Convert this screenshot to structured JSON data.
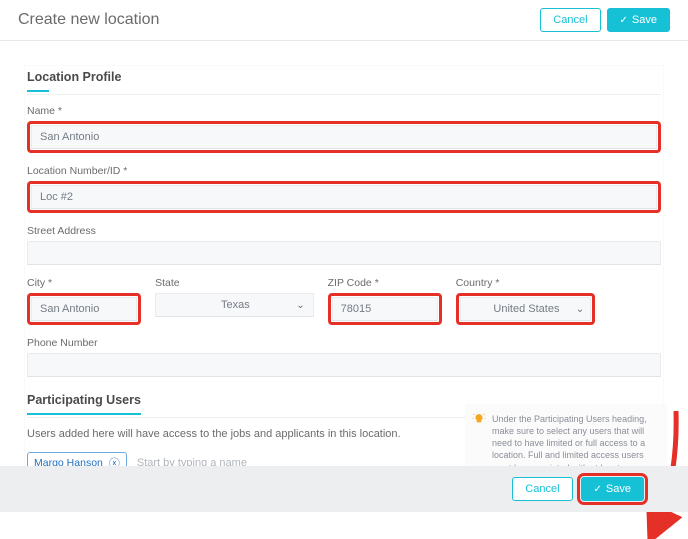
{
  "header": {
    "title": "Create new location",
    "cancel_label": "Cancel",
    "save_label": "Save"
  },
  "profile": {
    "title": "Location Profile",
    "name_label": "Name *",
    "name_value": "San Antonio",
    "locnum_label": "Location Number/ID *",
    "locnum_value": "Loc #2",
    "street_label": "Street Address",
    "street_value": "",
    "city_label": "City *",
    "city_value": "San Antonio",
    "state_label": "State",
    "state_value": "Texas",
    "zip_label": "ZIP Code *",
    "zip_value": "78015",
    "country_label": "Country *",
    "country_value": "United States",
    "phone_label": "Phone Number",
    "phone_value": ""
  },
  "users": {
    "title": "Participating Users",
    "description": "Users added here will have access to the jobs and applicants in this location.",
    "chips": [
      "Margo Hanson"
    ],
    "placeholder": "Start by typing a name"
  },
  "tip": "Under the Participating Users heading, make sure to select any users that will need to have limited or full access to a location. Full and limited access users must be associated with at least one location in order to take any action or view any applicants in their account.",
  "footer": {
    "cancel_label": "Cancel",
    "save_label": "Save"
  }
}
